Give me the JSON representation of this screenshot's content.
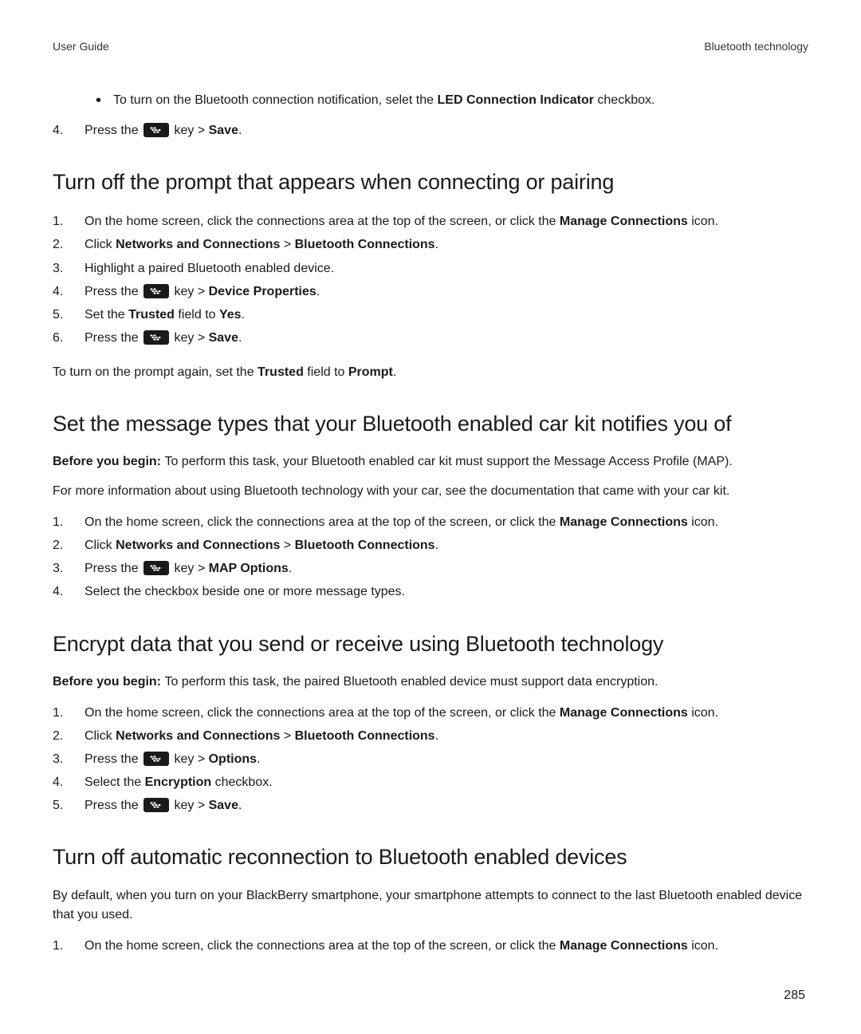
{
  "header": {
    "left": "User Guide",
    "right": "Bluetooth technology"
  },
  "intro": {
    "bullet1_a": "To turn on the Bluetooth connection notification, selet the ",
    "bullet1_b": "LED Connection Indicator",
    "bullet1_c": " checkbox.",
    "step4_num": "4.",
    "step4_a": "Press the ",
    "step4_b": " key > ",
    "step4_c": "Save",
    "step4_d": "."
  },
  "s1": {
    "heading": "Turn off the prompt that appears when connecting or pairing",
    "n1": "1.",
    "t1_a": "On the home screen, click the connections area at the top of the screen, or click the ",
    "t1_b": "Manage Connections",
    "t1_c": " icon.",
    "n2": "2.",
    "t2_a": "Click ",
    "t2_b": "Networks and Connections",
    "t2_c": " > ",
    "t2_d": "Bluetooth Connections",
    "t2_e": ".",
    "n3": "3.",
    "t3": "Highlight a paired Bluetooth enabled device.",
    "n4": "4.",
    "t4_a": "Press the ",
    "t4_b": " key > ",
    "t4_c": "Device Properties",
    "t4_d": ".",
    "n5": "5.",
    "t5_a": "Set the ",
    "t5_b": "Trusted",
    "t5_c": " field to ",
    "t5_d": "Yes",
    "t5_e": ".",
    "n6": "6.",
    "t6_a": "Press the ",
    "t6_b": " key > ",
    "t6_c": "Save",
    "t6_d": ".",
    "p_a": "To turn on the prompt again, set the ",
    "p_b": "Trusted",
    "p_c": " field to ",
    "p_d": "Prompt",
    "p_e": "."
  },
  "s2": {
    "heading": "Set the message types that your Bluetooth enabled car kit notifies you of",
    "p1_a": "Before you begin: ",
    "p1_b": "To perform this task, your Bluetooth enabled car kit must support the Message Access Profile (MAP).",
    "p2": "For more information about using Bluetooth technology with your car, see the documentation that came with your car kit.",
    "n1": "1.",
    "t1_a": "On the home screen, click the connections area at the top of the screen, or click the ",
    "t1_b": "Manage Connections",
    "t1_c": " icon.",
    "n2": "2.",
    "t2_a": "Click ",
    "t2_b": "Networks and Connections",
    "t2_c": " > ",
    "t2_d": "Bluetooth Connections",
    "t2_e": ".",
    "n3": "3.",
    "t3_a": "Press the ",
    "t3_b": " key > ",
    "t3_c": "MAP Options",
    "t3_d": ".",
    "n4": "4.",
    "t4": "Select the checkbox beside one or more message types."
  },
  "s3": {
    "heading": "Encrypt data that you send or receive using Bluetooth technology",
    "p1_a": "Before you begin: ",
    "p1_b": "To perform this task, the paired Bluetooth enabled device must support data encryption.",
    "n1": "1.",
    "t1_a": "On the home screen, click the connections area at the top of the screen, or click the ",
    "t1_b": "Manage Connections",
    "t1_c": " icon.",
    "n2": "2.",
    "t2_a": "Click ",
    "t2_b": "Networks and Connections",
    "t2_c": " > ",
    "t2_d": "Bluetooth Connections",
    "t2_e": ".",
    "n3": "3.",
    "t3_a": "Press the ",
    "t3_b": " key > ",
    "t3_c": "Options",
    "t3_d": ".",
    "n4": "4.",
    "t4_a": "Select the ",
    "t4_b": "Encryption",
    "t4_c": " checkbox.",
    "n5": "5.",
    "t5_a": "Press the ",
    "t5_b": " key > ",
    "t5_c": "Save",
    "t5_d": "."
  },
  "s4": {
    "heading": "Turn off automatic reconnection to Bluetooth enabled devices",
    "p1": "By default, when you turn on your BlackBerry smartphone, your smartphone attempts to connect to the last Bluetooth enabled device that you used.",
    "n1": "1.",
    "t1_a": "On the home screen, click the connections area at the top of the screen, or click the ",
    "t1_b": "Manage Connections",
    "t1_c": " icon."
  },
  "page_number": "285"
}
